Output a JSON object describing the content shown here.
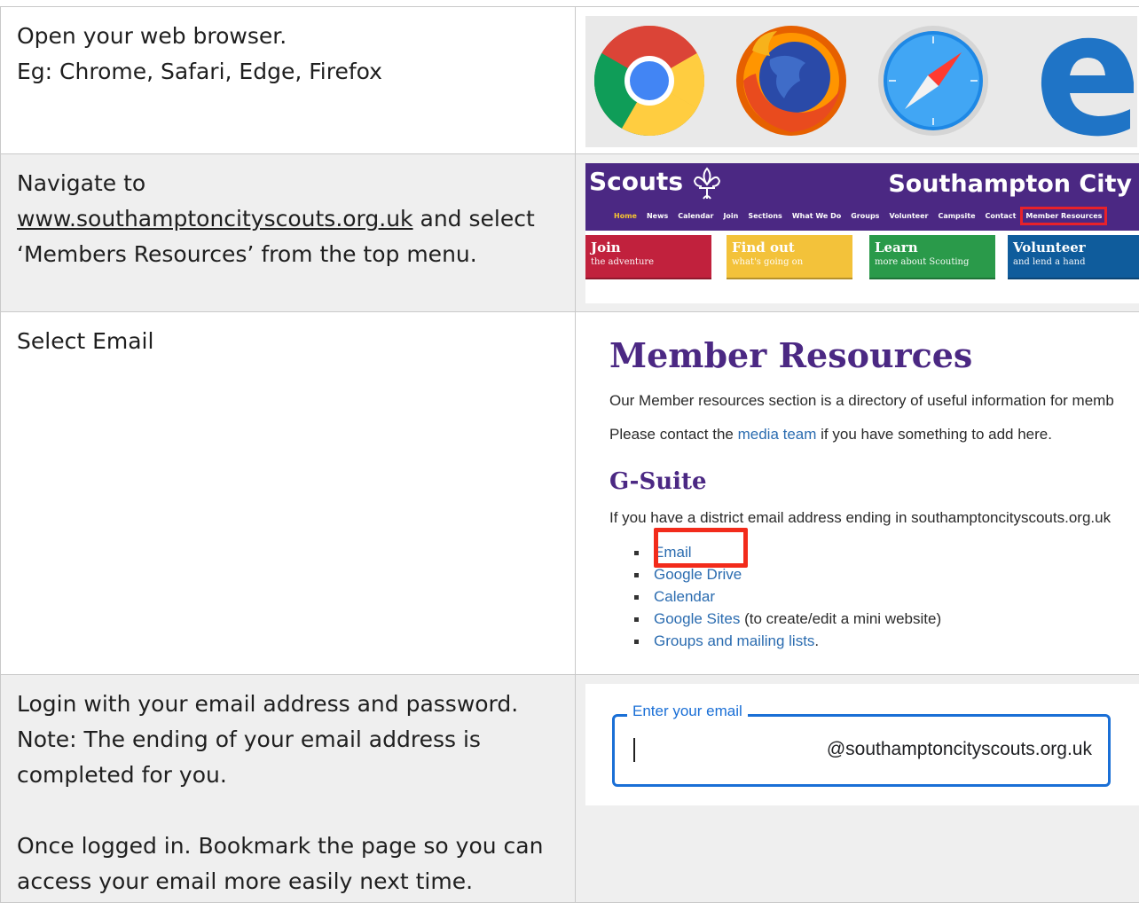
{
  "steps": [
    {
      "lines": [
        "Open your web browser.",
        "Eg: Chrome, Safari, Edge, Firefox"
      ]
    },
    {
      "line1": "Navigate to",
      "link": "www.southamptoncityscouts.org.uk",
      "line2_rest": " and select",
      "line3": "‘Members Resources’ from the top menu."
    },
    {
      "lines": [
        "Select Email"
      ]
    },
    {
      "lines": [
        "Login with your email address and password.",
        "Note: The ending of your email address is",
        "completed for you."
      ],
      "lines_after": [
        "Once logged in. Bookmark the page so you can",
        "access your email more easily next time."
      ]
    }
  ],
  "browsers": {
    "icons": [
      "chrome-icon",
      "firefox-icon",
      "safari-icon",
      "edge-icon"
    ]
  },
  "scouts_site": {
    "logo_text": "Scouts",
    "city": "Southampton City",
    "nav": [
      "Home",
      "News",
      "Calendar",
      "Join",
      "Sections",
      "What We Do",
      "Groups",
      "Volunteer",
      "Campsite",
      "Contact",
      "Member Resources"
    ],
    "tiles": [
      {
        "title": "Join",
        "sub": "the adventure",
        "color": "#c1213d"
      },
      {
        "title": "Find out",
        "sub": "what's going on",
        "color": "#f3c23a"
      },
      {
        "title": "Learn",
        "sub": "more about Scouting",
        "color": "#2a9a4a"
      },
      {
        "title": "Volunteer",
        "sub": "and lend a hand",
        "color": "#0f5c9c"
      }
    ],
    "colors": {
      "purple": "#4b2883",
      "highlight": "#e8212a"
    }
  },
  "member_resources": {
    "title": "Member Resources",
    "p1": "Our Member resources section is a directory of useful information for memb",
    "p2_before": "Please contact the ",
    "p2_link": "media team",
    "p2_after": " if you have something to add here.",
    "subtitle": "G-Suite",
    "p3": "If you have a district email address ending in southamptoncityscouts.org.uk",
    "list": [
      {
        "link": "Email",
        "rest": ""
      },
      {
        "link": "Google Drive",
        "rest": ""
      },
      {
        "link": "Calendar",
        "rest": ""
      },
      {
        "link": "Google Sites",
        "rest": " (to create/edit a mini website)"
      },
      {
        "link": "Groups and mailing lists",
        "rest": "."
      }
    ]
  },
  "login": {
    "label": "Enter your email",
    "suffix": "@southamptoncityscouts.org.uk"
  }
}
